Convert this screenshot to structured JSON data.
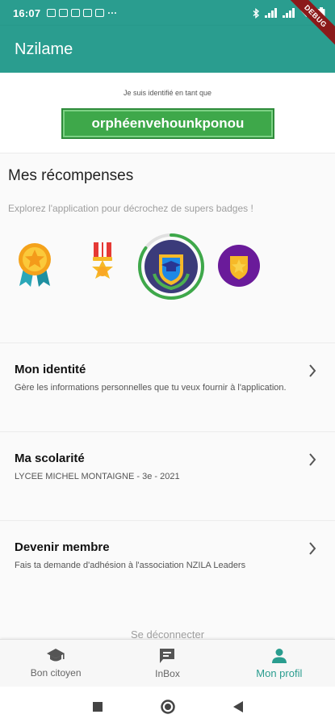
{
  "status_bar": {
    "time": "16:07",
    "extra": "···",
    "debug_label": "DEBUG"
  },
  "app_bar": {
    "title": "Nzilame"
  },
  "identity": {
    "caption": "Je suis identifié en tant que",
    "username": "orphéenvehounkponou"
  },
  "rewards": {
    "title": "Mes récompenses",
    "subtitle": "Explorez l'application pour décrochez de supers badges !",
    "badges": [
      "medal-ribbon-icon",
      "military-medal-icon",
      "graduation-shield-badge-icon",
      "police-badge-icon"
    ],
    "selected_badge_progress": 0.85,
    "colors": {
      "ring": "#3ea84a",
      "gold": "#f6b928",
      "purple": "#6a1b9a",
      "teal": "#2a9d8f"
    }
  },
  "items": [
    {
      "title": "Mon identité",
      "description": "Gère les informations personnelles que tu veux fournir à l'application."
    },
    {
      "title": "Ma scolarité",
      "description": "LYCEE MICHEL MONTAIGNE - 3e - 2021"
    },
    {
      "title": "Devenir membre",
      "description": "Fais ta demande d'adhésion à l'association NZILA Leaders"
    }
  ],
  "logout_label": "Se déconnecter",
  "bottom_nav": [
    {
      "label": "Bon citoyen",
      "icon": "graduation-cap-icon"
    },
    {
      "label": "InBox",
      "icon": "inbox-icon"
    },
    {
      "label": "Mon profil",
      "icon": "person-icon",
      "active": true
    }
  ],
  "accent_color": "#2a9d8f"
}
